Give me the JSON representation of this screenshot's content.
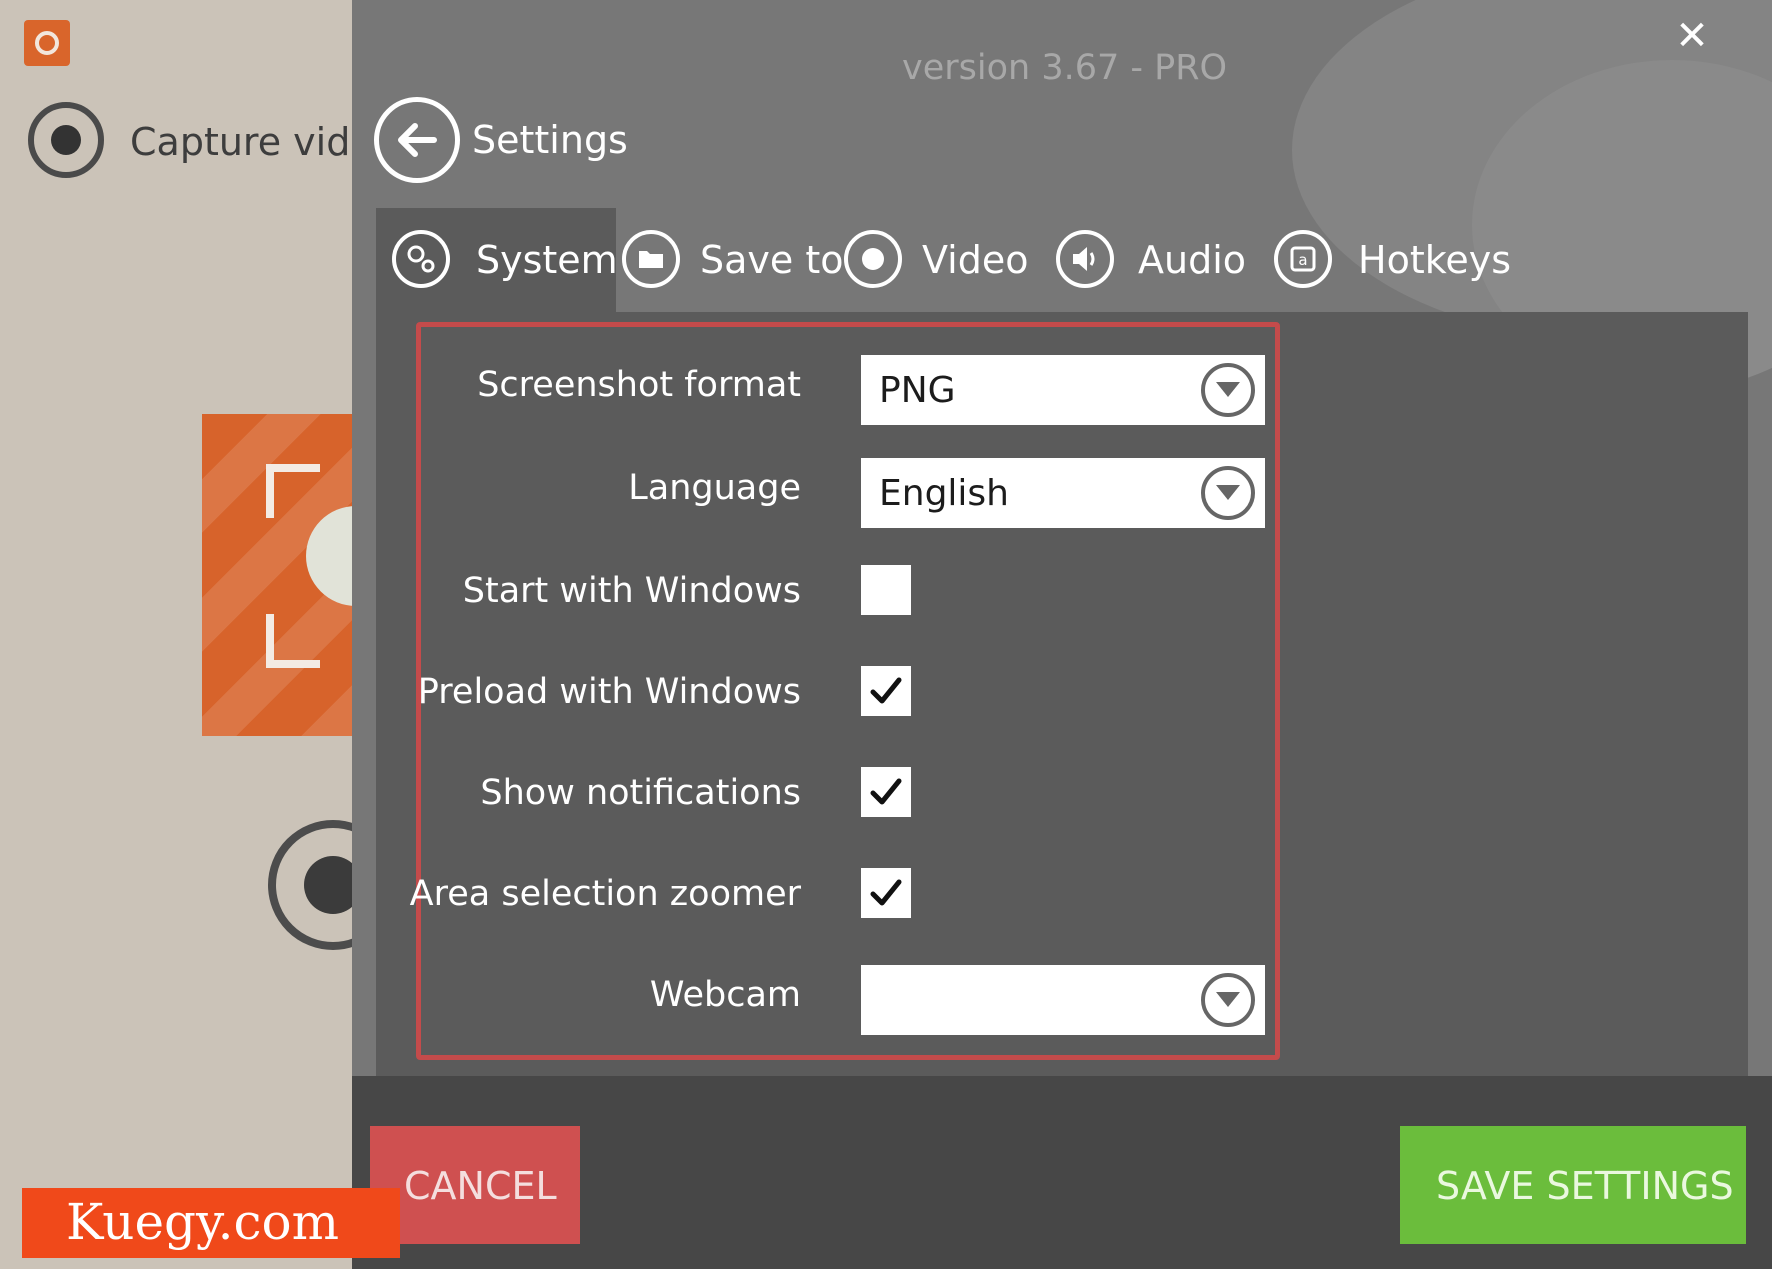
{
  "background_app": {
    "capture_label": "Capture video"
  },
  "window": {
    "version": "version 3.67 - PRO",
    "title": "Settings",
    "close_symbol": "✕"
  },
  "tabs": [
    {
      "label": "System",
      "icon": "gears-icon",
      "active": true
    },
    {
      "label": "Save to",
      "icon": "folder-icon",
      "active": false
    },
    {
      "label": "Video",
      "icon": "record-icon",
      "active": false
    },
    {
      "label": "Audio",
      "icon": "speaker-icon",
      "active": false
    },
    {
      "label": "Hotkeys",
      "icon": "key-icon",
      "active": false
    }
  ],
  "settings": {
    "screenshot_format": {
      "label": "Screenshot format",
      "value": "PNG"
    },
    "language": {
      "label": "Language",
      "value": "English"
    },
    "start_with_windows": {
      "label": "Start with Windows",
      "checked": false
    },
    "preload_with_windows": {
      "label": "Preload with Windows",
      "checked": true
    },
    "show_notifications": {
      "label": "Show notifications",
      "checked": true
    },
    "area_selection_zoomer": {
      "label": "Area selection zoomer",
      "checked": true
    },
    "webcam": {
      "label": "Webcam",
      "value": ""
    }
  },
  "footer": {
    "cancel_label": "CANCEL",
    "save_label": "SAVE SETTINGS"
  },
  "watermark": "Kuegy.com",
  "colors": {
    "panel_border": "#c44b4b",
    "cancel": "#cf5050",
    "save": "#6bbd3c",
    "watermark": "#f0491a",
    "brand_orange": "#d7632b"
  }
}
